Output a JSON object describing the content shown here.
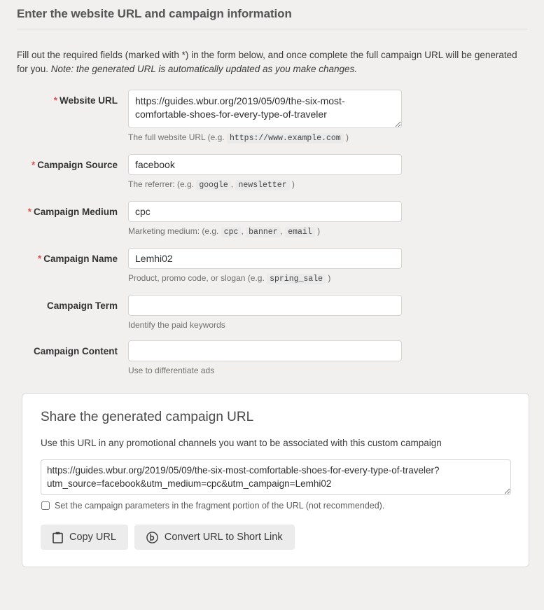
{
  "header": {
    "title": "Enter the website URL and campaign information"
  },
  "intro": {
    "text_main": "Fill out the required fields (marked with *) in the form below, and once complete the full campaign URL will be generated for you.",
    "text_note": "Note: the generated URL is automatically updated as you make changes."
  },
  "form": {
    "required_marker": "*",
    "fields": [
      {
        "label": "Website URL",
        "required": true,
        "value": "https://guides.wbur.org/2019/05/09/the-six-most-comfortable-shoes-for-every-type-of-traveler",
        "placeholder": "",
        "help_prefix": "The full website URL (e.g.",
        "help_codes": [
          "https://www.example.com"
        ],
        "help_suffix": ")"
      },
      {
        "label": "Campaign Source",
        "required": true,
        "value": "facebook",
        "placeholder": "",
        "help_prefix": "The referrer: (e.g.",
        "help_codes": [
          "google",
          "newsletter"
        ],
        "help_suffix": ")"
      },
      {
        "label": "Campaign Medium",
        "required": true,
        "value": "cpc",
        "placeholder": "",
        "help_prefix": "Marketing medium: (e.g.",
        "help_codes": [
          "cpc",
          "banner",
          "email"
        ],
        "help_suffix": ")"
      },
      {
        "label": "Campaign Name",
        "required": true,
        "value": "Lemhi02",
        "placeholder": "",
        "help_prefix": "Product, promo code, or slogan (e.g.",
        "help_codes": [
          "spring_sale"
        ],
        "help_suffix": ")"
      },
      {
        "label": "Campaign Term",
        "required": false,
        "value": "",
        "placeholder": "",
        "help_prefix": "Identify the paid keywords",
        "help_codes": [],
        "help_suffix": ""
      },
      {
        "label": "Campaign Content",
        "required": false,
        "value": "",
        "placeholder": "",
        "help_prefix": "Use to differentiate ads",
        "help_codes": [],
        "help_suffix": ""
      }
    ]
  },
  "share": {
    "title": "Share the generated campaign URL",
    "subtitle": "Use this URL in any promotional channels you want to be associated with this custom campaign",
    "generated_url": "https://guides.wbur.org/2019/05/09/the-six-most-comfortable-shoes-for-every-type-of-traveler?utm_source=facebook&utm_medium=cpc&utm_campaign=Lemhi02",
    "fragment_checkbox_label": "Set the campaign parameters in the fragment portion of the URL (not recommended).",
    "fragment_checkbox_checked": false,
    "copy_button_label": "Copy URL",
    "copy_button_icon": "clipboard-icon",
    "shorten_button_label": "Convert URL to Short Link",
    "shorten_button_icon": "bitly-icon"
  },
  "colors": {
    "page_background": "#f1f0ee",
    "panel_background": "#ffffff",
    "required_marker": "#d9534f",
    "border": "#d6d4d2",
    "button_background": "#ececec",
    "help_text": "#6f6f6f"
  }
}
